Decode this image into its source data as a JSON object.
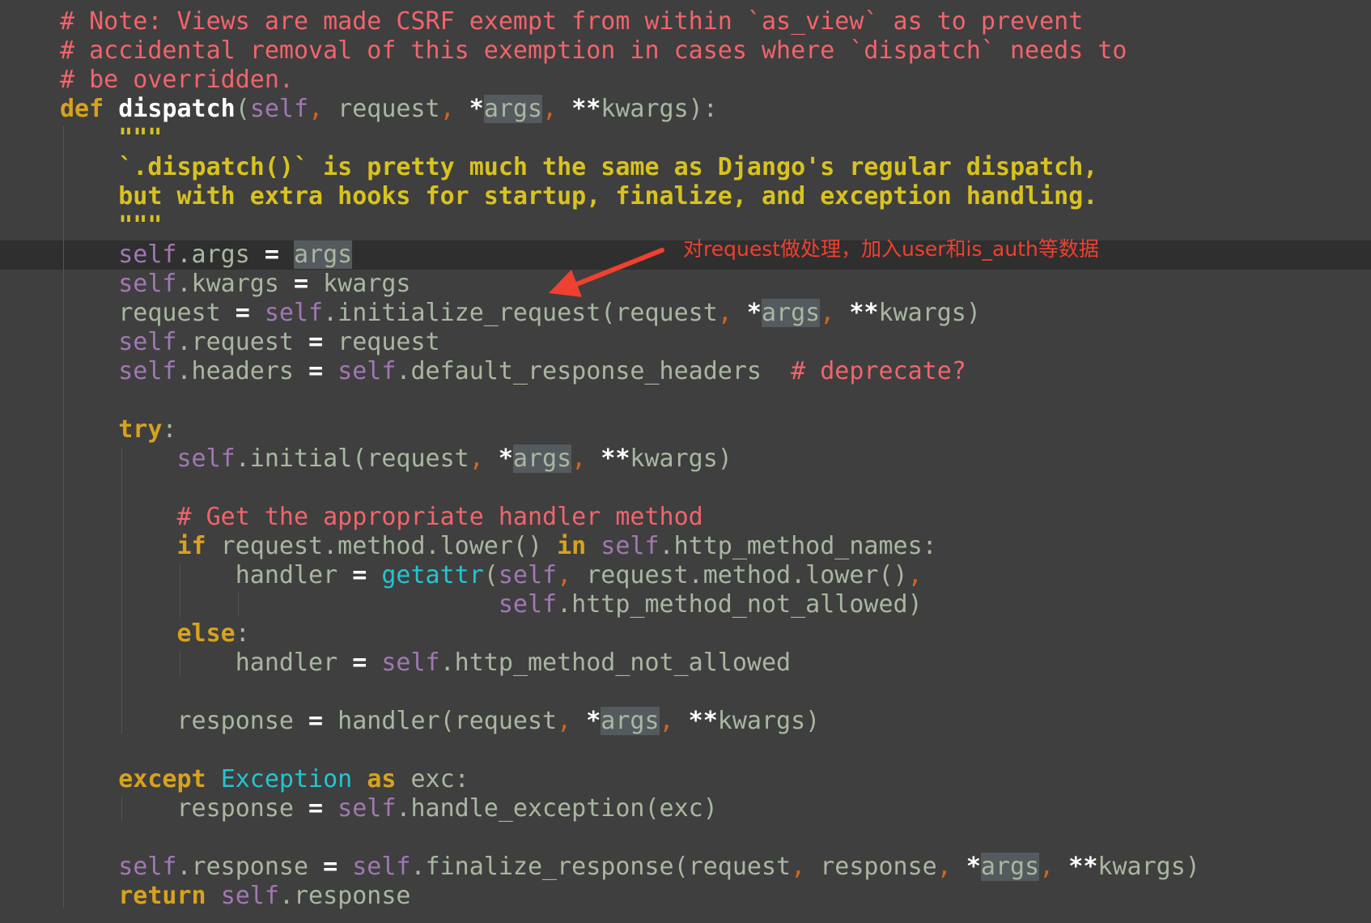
{
  "annotation": {
    "text": "对request做处理，加入user和is_auth等数据",
    "color": "#f04030"
  },
  "colors": {
    "background": "#3f3f3f",
    "current_line": "#2f2f2f",
    "comment": "#f2646b",
    "keyword": "#d7a21d",
    "self": "#a277b3",
    "docstring": "#d8c21f",
    "builtin": "#22c5d1",
    "identifier": "#a9b7a0"
  },
  "code": {
    "lines": [
      [
        {
          "t": "# Note: Views are made CSRF exempt from within `as_view` as to prevent",
          "c": "comment"
        }
      ],
      [
        {
          "t": "# accidental removal of this exemption in cases where `dispatch` needs to",
          "c": "comment"
        }
      ],
      [
        {
          "t": "# be overridden.",
          "c": "comment"
        }
      ],
      [
        {
          "t": "def",
          "c": "kw"
        },
        {
          "t": " ",
          "c": "id"
        },
        {
          "t": "dispatch",
          "c": "fn-def"
        },
        {
          "t": "(",
          "c": "id"
        },
        {
          "t": "self",
          "c": "self"
        },
        {
          "t": ",",
          "c": "punct"
        },
        {
          "t": " request",
          "c": "id"
        },
        {
          "t": ",",
          "c": "punct"
        },
        {
          "t": " ",
          "c": "id"
        },
        {
          "t": "*",
          "c": "op"
        },
        {
          "t": "args",
          "c": "id",
          "hl": true
        },
        {
          "t": ",",
          "c": "punct"
        },
        {
          "t": " ",
          "c": "id"
        },
        {
          "t": "**",
          "c": "op"
        },
        {
          "t": "kwargs):",
          "c": "id"
        }
      ],
      [
        {
          "t": "    \"\"\"",
          "c": "doc"
        }
      ],
      [
        {
          "t": "    `.dispatch()` is pretty much the same as Django's regular dispatch,",
          "c": "doc"
        }
      ],
      [
        {
          "t": "    but with extra hooks for startup, finalize, and exception handling.",
          "c": "doc"
        }
      ],
      [
        {
          "t": "    \"\"\"",
          "c": "doc"
        }
      ],
      [
        {
          "t": "    ",
          "c": "id"
        },
        {
          "t": "self",
          "c": "self"
        },
        {
          "t": ".args ",
          "c": "id"
        },
        {
          "t": "=",
          "c": "op"
        },
        {
          "t": " ",
          "c": "id"
        },
        {
          "t": "args",
          "c": "id",
          "hl": true
        }
      ],
      [
        {
          "t": "    ",
          "c": "id"
        },
        {
          "t": "self",
          "c": "self"
        },
        {
          "t": ".kwargs ",
          "c": "id"
        },
        {
          "t": "=",
          "c": "op"
        },
        {
          "t": " kwargs",
          "c": "id"
        }
      ],
      [
        {
          "t": "    request ",
          "c": "id"
        },
        {
          "t": "=",
          "c": "op"
        },
        {
          "t": " ",
          "c": "id"
        },
        {
          "t": "self",
          "c": "self"
        },
        {
          "t": ".initialize_request(request",
          "c": "id"
        },
        {
          "t": ",",
          "c": "punct"
        },
        {
          "t": " ",
          "c": "id"
        },
        {
          "t": "*",
          "c": "op"
        },
        {
          "t": "args",
          "c": "id",
          "hl": true
        },
        {
          "t": ",",
          "c": "punct"
        },
        {
          "t": " ",
          "c": "id"
        },
        {
          "t": "**",
          "c": "op"
        },
        {
          "t": "kwargs)",
          "c": "id"
        }
      ],
      [
        {
          "t": "    ",
          "c": "id"
        },
        {
          "t": "self",
          "c": "self"
        },
        {
          "t": ".request ",
          "c": "id"
        },
        {
          "t": "=",
          "c": "op"
        },
        {
          "t": " request",
          "c": "id"
        }
      ],
      [
        {
          "t": "    ",
          "c": "id"
        },
        {
          "t": "self",
          "c": "self"
        },
        {
          "t": ".headers ",
          "c": "id"
        },
        {
          "t": "=",
          "c": "op"
        },
        {
          "t": " ",
          "c": "id"
        },
        {
          "t": "self",
          "c": "self"
        },
        {
          "t": ".default_response_headers  ",
          "c": "id"
        },
        {
          "t": "# deprecate?",
          "c": "comment"
        }
      ],
      [],
      [
        {
          "t": "    ",
          "c": "id"
        },
        {
          "t": "try",
          "c": "kw"
        },
        {
          "t": ":",
          "c": "id"
        }
      ],
      [
        {
          "t": "        ",
          "c": "id"
        },
        {
          "t": "self",
          "c": "self"
        },
        {
          "t": ".initial(request",
          "c": "id"
        },
        {
          "t": ",",
          "c": "punct"
        },
        {
          "t": " ",
          "c": "id"
        },
        {
          "t": "*",
          "c": "op"
        },
        {
          "t": "args",
          "c": "id",
          "hl": true
        },
        {
          "t": ",",
          "c": "punct"
        },
        {
          "t": " ",
          "c": "id"
        },
        {
          "t": "**",
          "c": "op"
        },
        {
          "t": "kwargs)",
          "c": "id"
        }
      ],
      [],
      [
        {
          "t": "        ",
          "c": "id"
        },
        {
          "t": "# Get the appropriate handler method",
          "c": "comment"
        }
      ],
      [
        {
          "t": "        ",
          "c": "id"
        },
        {
          "t": "if",
          "c": "kw"
        },
        {
          "t": " request.method.lower() ",
          "c": "id"
        },
        {
          "t": "in",
          "c": "kw"
        },
        {
          "t": " ",
          "c": "id"
        },
        {
          "t": "self",
          "c": "self"
        },
        {
          "t": ".http_method_names:",
          "c": "id"
        }
      ],
      [
        {
          "t": "            handler ",
          "c": "id"
        },
        {
          "t": "=",
          "c": "op"
        },
        {
          "t": " ",
          "c": "id"
        },
        {
          "t": "getattr",
          "c": "builtin"
        },
        {
          "t": "(",
          "c": "id"
        },
        {
          "t": "self",
          "c": "self"
        },
        {
          "t": ",",
          "c": "punct"
        },
        {
          "t": " request.method.lower()",
          "c": "id"
        },
        {
          "t": ",",
          "c": "punct"
        }
      ],
      [
        {
          "t": "                              ",
          "c": "id"
        },
        {
          "t": "self",
          "c": "self"
        },
        {
          "t": ".http_method_not_allowed)",
          "c": "id"
        }
      ],
      [
        {
          "t": "        ",
          "c": "id"
        },
        {
          "t": "else",
          "c": "kw"
        },
        {
          "t": ":",
          "c": "id"
        }
      ],
      [
        {
          "t": "            handler ",
          "c": "id"
        },
        {
          "t": "=",
          "c": "op"
        },
        {
          "t": " ",
          "c": "id"
        },
        {
          "t": "self",
          "c": "self"
        },
        {
          "t": ".http_method_not_allowed",
          "c": "id"
        }
      ],
      [],
      [
        {
          "t": "        response ",
          "c": "id"
        },
        {
          "t": "=",
          "c": "op"
        },
        {
          "t": " handler(request",
          "c": "id"
        },
        {
          "t": ",",
          "c": "punct"
        },
        {
          "t": " ",
          "c": "id"
        },
        {
          "t": "*",
          "c": "op"
        },
        {
          "t": "args",
          "c": "id",
          "hl": true
        },
        {
          "t": ",",
          "c": "punct"
        },
        {
          "t": " ",
          "c": "id"
        },
        {
          "t": "**",
          "c": "op"
        },
        {
          "t": "kwargs)",
          "c": "id"
        }
      ],
      [],
      [
        {
          "t": "    ",
          "c": "id"
        },
        {
          "t": "except",
          "c": "kw"
        },
        {
          "t": " ",
          "c": "id"
        },
        {
          "t": "Exception",
          "c": "builtin"
        },
        {
          "t": " ",
          "c": "id"
        },
        {
          "t": "as",
          "c": "kw"
        },
        {
          "t": " exc:",
          "c": "id"
        }
      ],
      [
        {
          "t": "        response ",
          "c": "id"
        },
        {
          "t": "=",
          "c": "op"
        },
        {
          "t": " ",
          "c": "id"
        },
        {
          "t": "self",
          "c": "self"
        },
        {
          "t": ".handle_exception(exc)",
          "c": "id"
        }
      ],
      [],
      [
        {
          "t": "    ",
          "c": "id"
        },
        {
          "t": "self",
          "c": "self"
        },
        {
          "t": ".response ",
          "c": "id"
        },
        {
          "t": "=",
          "c": "op"
        },
        {
          "t": " ",
          "c": "id"
        },
        {
          "t": "self",
          "c": "self"
        },
        {
          "t": ".finalize_response(request",
          "c": "id"
        },
        {
          "t": ",",
          "c": "punct"
        },
        {
          "t": " response",
          "c": "id"
        },
        {
          "t": ",",
          "c": "punct"
        },
        {
          "t": " ",
          "c": "id"
        },
        {
          "t": "*",
          "c": "op"
        },
        {
          "t": "args",
          "c": "id",
          "hl": true
        },
        {
          "t": ",",
          "c": "punct"
        },
        {
          "t": " ",
          "c": "id"
        },
        {
          "t": "**",
          "c": "op"
        },
        {
          "t": "kwargs)",
          "c": "id"
        }
      ],
      [
        {
          "t": "    ",
          "c": "id"
        },
        {
          "t": "return",
          "c": "kw"
        },
        {
          "t": " ",
          "c": "id"
        },
        {
          "t": "self",
          "c": "self"
        },
        {
          "t": ".response",
          "c": "id"
        }
      ]
    ]
  }
}
